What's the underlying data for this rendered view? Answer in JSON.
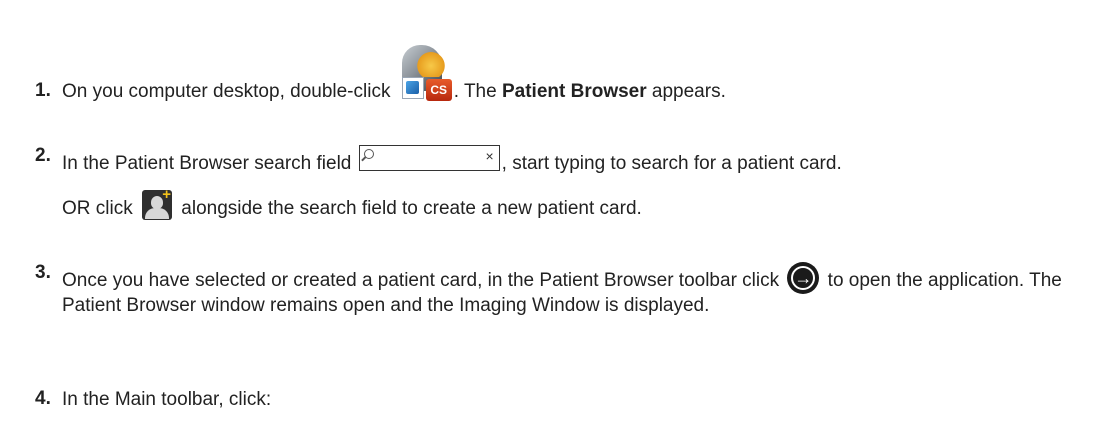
{
  "steps": [
    {
      "number": "1.",
      "text_before": "On you computer desktop, double-click ",
      "text_mid": ". The ",
      "bold": "Patient Browser",
      "text_after": " appears.",
      "icon": "cs-imaging-app-icon",
      "icon_badge": "CS"
    },
    {
      "number": "2.",
      "text_before": "In the Patient Browser search field ",
      "text_after": ", start typing to search for a patient card.",
      "icon": "search-field-icon",
      "search_clear": "×",
      "line2_before": "OR click ",
      "line2_after": " alongside the search field to create a new patient card.",
      "line2_icon": "new-patient-icon",
      "line2_icon_plus": "+"
    },
    {
      "number": "3.",
      "text_before": "Once you have selected or created a patient card, in the Patient Browser toolbar click ",
      "text_after": " to open the application. The Patient Browser window remains open and the Imaging Window is displayed.",
      "icon": "open-application-icon",
      "icon_glyph": "→"
    },
    {
      "number": "4.",
      "text": "In the Main toolbar, click:"
    }
  ]
}
